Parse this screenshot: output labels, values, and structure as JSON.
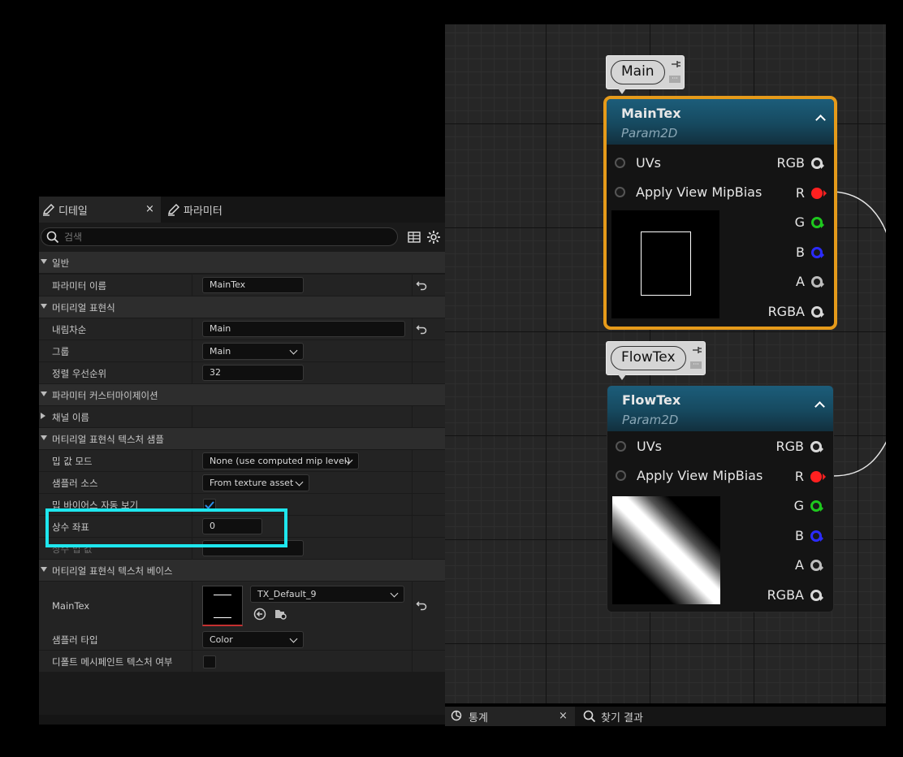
{
  "details": {
    "tabs": [
      {
        "label": "디테일",
        "close": "×"
      },
      {
        "label": "파라미터"
      }
    ],
    "search_placeholder": "검색",
    "categories": {
      "general": "일반",
      "material_expression": "머티리얼 표현식",
      "param_customization": "파라미터 커스터마이제이션",
      "tex_sample": "머티리얼 표현식 텍스처 샘플",
      "tex_base": "머티리얼 표현식 텍스처 베이스"
    },
    "props": {
      "param_name": {
        "label": "파라미터 이름",
        "value": "MainTex"
      },
      "desc": {
        "label": "내림차순",
        "value": "Main"
      },
      "group": {
        "label": "그룹",
        "value": "Main"
      },
      "sort_priority": {
        "label": "정렬 우선순위",
        "value": "32"
      },
      "channel_names": {
        "label": "채널 이름"
      },
      "mip_mode": {
        "label": "밉 값 모드",
        "value": "None (use computed mip level)"
      },
      "sampler_source": {
        "label": "샘플러 소스",
        "value": "From texture asset"
      },
      "auto_mip_bias": {
        "label": "밉 바이어스 자동 보기"
      },
      "const_coord": {
        "label": "상수 좌표",
        "value": "0"
      },
      "const_mip": {
        "label": "상수 밉 값"
      },
      "maintex": {
        "label": "MainTex",
        "value": "TX_Default_9"
      },
      "sampler_type": {
        "label": "샘플러 타입",
        "value": "Color"
      },
      "default_mesh_tex": {
        "label": "디폴트 메시페인트 텍스처 여부"
      }
    }
  },
  "graph": {
    "comments": [
      {
        "label": "Main"
      },
      {
        "label": "FlowTex"
      }
    ],
    "nodes": [
      {
        "title": "MainTex",
        "subtitle": "Param2D",
        "inputs": [
          "UVs",
          "Apply View MipBias"
        ],
        "outputs": [
          "RGB",
          "R",
          "G",
          "B",
          "A",
          "RGBA"
        ]
      },
      {
        "title": "FlowTex",
        "subtitle": "Param2D",
        "inputs": [
          "UVs",
          "Apply View MipBias"
        ],
        "outputs": [
          "RGB",
          "R",
          "G",
          "B",
          "A",
          "RGBA"
        ]
      }
    ],
    "pin_colors": {
      "RGB": "#d8d8d8",
      "R": "#ff2020",
      "G": "#1ec81e",
      "B": "#2b2bff",
      "A": "#bdbdbd",
      "RGBA": "#d8d8d8"
    },
    "selection_color": "#e59a1a"
  },
  "bottom_tabs": [
    {
      "label": "통계",
      "close": "×"
    },
    {
      "label": "찾기 결과"
    }
  ],
  "highlight_color": "#1ee6ee"
}
